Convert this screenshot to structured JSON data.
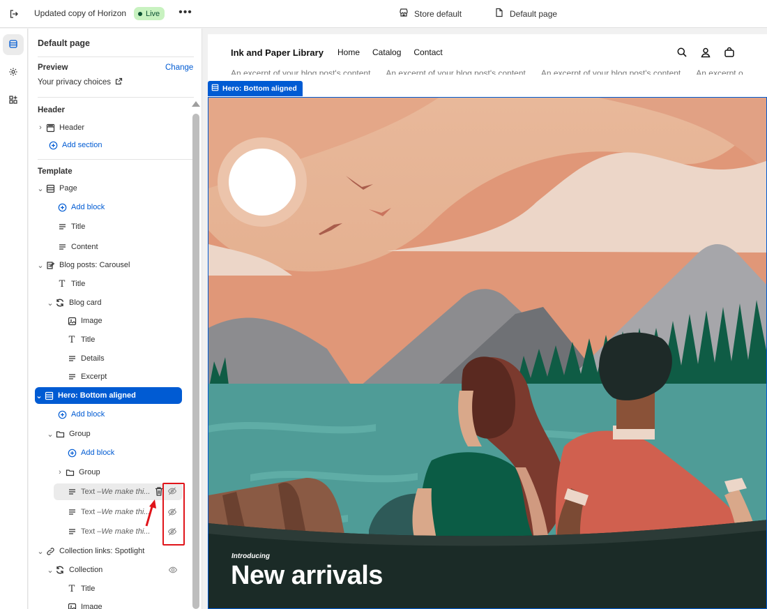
{
  "topbar": {
    "theme_name": "Updated copy of Horizon",
    "status": "Live",
    "more": "•••",
    "store_select": "Store default",
    "page_select": "Default page"
  },
  "sidebar": {
    "title": "Default page",
    "preview_label": "Preview",
    "preview_change": "Change",
    "privacy_link": "Your privacy choices",
    "header_section": "Header",
    "header_item": "Header",
    "add_section": "Add section",
    "template_section": "Template",
    "tree": {
      "page": "Page",
      "page_add_block": "Add block",
      "page_title": "Title",
      "page_content": "Content",
      "blog_carousel": "Blog posts: Carousel",
      "blog_title": "Title",
      "blog_card": "Blog card",
      "card_image": "Image",
      "card_title": "Title",
      "card_details": "Details",
      "card_excerpt": "Excerpt",
      "hero": "Hero: Bottom aligned",
      "hero_add_block": "Add block",
      "group": "Group",
      "group_add_block": "Add block",
      "group_nested": "Group",
      "text_prefix": "Text – ",
      "text_1": "We make thi...",
      "text_2": "We make thi...",
      "text_3": "We make thi...",
      "collection_links": "Collection links: Spotlight",
      "collection": "Collection",
      "col_title": "Title",
      "col_image": "Image"
    }
  },
  "preview": {
    "site_title": "Ink and Paper Library",
    "nav": [
      "Home",
      "Catalog",
      "Contact"
    ],
    "marquee": [
      "An excerpt of your blog post's content",
      "An excerpt of your blog post's content",
      "An excerpt of your blog post's content",
      "An excerpt o"
    ],
    "hero_tag": "Hero: Bottom aligned",
    "hero_eyebrow": "Introducing",
    "hero_heading": "New arrivals"
  },
  "colors": {
    "accent": "#005bd3",
    "live_bg": "#c8f2c0",
    "annotation": "#e0141a"
  }
}
